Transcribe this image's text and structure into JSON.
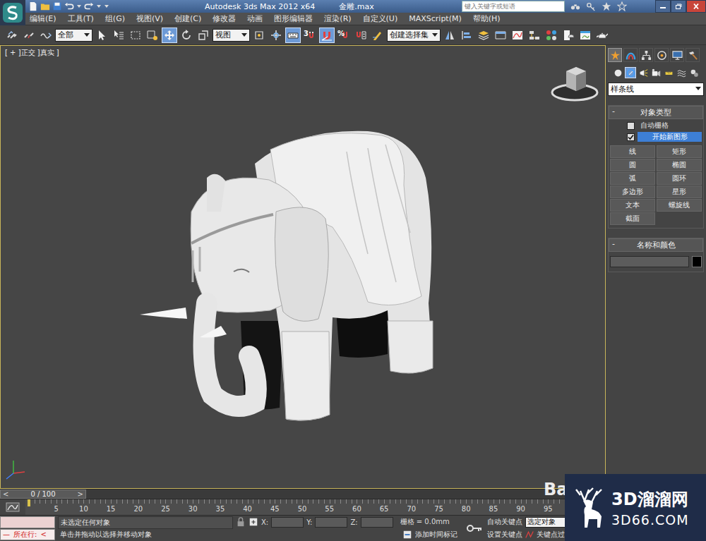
{
  "titlebar": {
    "app_title": "Autodesk 3ds Max  2012 x64",
    "file_name": "金雕.max",
    "search_placeholder": "键入关键字或短语"
  },
  "menu": [
    "编辑(E)",
    "工具(T)",
    "组(G)",
    "视图(V)",
    "创建(C)",
    "修改器",
    "动画",
    "图形编辑器",
    "渲染(R)",
    "自定义(U)",
    "MAXScript(M)",
    "帮助(H)"
  ],
  "toolbar": {
    "items": [
      {
        "kind": "link",
        "selected": false
      },
      {
        "kind": "unlink",
        "selected": false
      },
      {
        "kind": "bind",
        "selected": false
      },
      {
        "kind": "dropdown",
        "value": "全部"
      },
      {
        "kind": "select",
        "selected": false
      },
      {
        "kind": "select-name",
        "selected": false
      },
      {
        "kind": "region",
        "selected": false
      },
      {
        "kind": "crossing",
        "selected": false
      },
      {
        "kind": "move",
        "selected": true
      },
      {
        "kind": "rotate",
        "selected": false
      },
      {
        "kind": "scale",
        "selected": false
      },
      {
        "kind": "dropdown",
        "value": "视图"
      },
      {
        "kind": "pivot",
        "selected": false
      },
      {
        "kind": "manipulate",
        "selected": false
      },
      {
        "kind": "shortcut",
        "selected": true
      },
      {
        "kind": "snap",
        "label": "3",
        "selected": false
      },
      {
        "kind": "angle-snap",
        "selected": true
      },
      {
        "kind": "percent-snap",
        "label": "%",
        "selected": false
      },
      {
        "kind": "spinner-snap",
        "selected": false
      },
      {
        "kind": "named-edit",
        "selected": false
      },
      {
        "kind": "dropdown",
        "value": "创建选择集"
      },
      {
        "kind": "mirror",
        "selected": false
      },
      {
        "kind": "align",
        "selected": false
      },
      {
        "kind": "layers",
        "selected": false
      },
      {
        "kind": "ribbon",
        "selected": false
      },
      {
        "kind": "curve-editor",
        "selected": false
      },
      {
        "kind": "schematic",
        "selected": false
      },
      {
        "kind": "material",
        "selected": false
      },
      {
        "kind": "render-setup",
        "selected": false
      },
      {
        "kind": "frame-window",
        "selected": false
      },
      {
        "kind": "render",
        "selected": false
      }
    ]
  },
  "viewport": {
    "label": "[ + ]正交 ]真实 ]",
    "active": true
  },
  "command_panel": {
    "tabs": [
      {
        "kind": "create",
        "selected": true
      },
      {
        "kind": "modify",
        "selected": false
      },
      {
        "kind": "hierarchy",
        "selected": false
      },
      {
        "kind": "motion",
        "selected": false
      },
      {
        "kind": "display",
        "selected": false
      },
      {
        "kind": "utilities",
        "selected": false
      }
    ],
    "categories": [
      {
        "kind": "geometry",
        "selected": false
      },
      {
        "kind": "shapes",
        "selected": true
      },
      {
        "kind": "lights",
        "selected": false
      },
      {
        "kind": "cameras",
        "selected": false
      },
      {
        "kind": "helpers",
        "selected": false
      },
      {
        "kind": "spacewarps",
        "selected": false
      },
      {
        "kind": "systems",
        "selected": false
      }
    ],
    "subcategory": "样条线",
    "object_type": {
      "toggle": "-",
      "title": "对象类型",
      "options": [
        {
          "label": "自动栅格",
          "checked": false,
          "highlighted": false
        },
        {
          "label": "开始新图形",
          "checked": true,
          "highlighted": true
        }
      ],
      "buttons": [
        "线",
        "矩形",
        "圆",
        "椭圆",
        "弧",
        "圆环",
        "多边形",
        "星形",
        "文本",
        "螺旋线",
        "截面"
      ]
    },
    "name_color": {
      "toggle": "-",
      "title": "名称和颜色",
      "name": "",
      "color": "#000000"
    }
  },
  "timeline": {
    "prev": "<",
    "next": ">",
    "position": "0 / 100",
    "level": 0,
    "current_frame": 0,
    "labels": [
      "5",
      "10",
      "15",
      "20",
      "25",
      "30",
      "35",
      "40",
      "45",
      "50",
      "55",
      "60",
      "65",
      "70",
      "75",
      "80",
      "85",
      "90",
      "95"
    ]
  },
  "status": {
    "prompt": {
      "mark": "—",
      "label": "所在行:",
      "arrow": "<"
    },
    "selection": "未选定任何对象",
    "hint": "单击并拖动以选择并移动对象",
    "locked": false,
    "coords": [
      {
        "axis": "X:",
        "value": ""
      },
      {
        "axis": "Y:",
        "value": ""
      },
      {
        "axis": "Z:",
        "value": ""
      }
    ],
    "grid": "栅格 = 0.0mm",
    "time_tag": "添加时间标记",
    "auto_key": {
      "label": "自动关键点",
      "on": false
    },
    "key_mode": "选定对象",
    "set_key": "设置关键点",
    "key_filters": "关键点过滤"
  },
  "watermark": {
    "baidu": "Ba",
    "site": "3D溜溜网",
    "domain": "3D66.COM"
  }
}
